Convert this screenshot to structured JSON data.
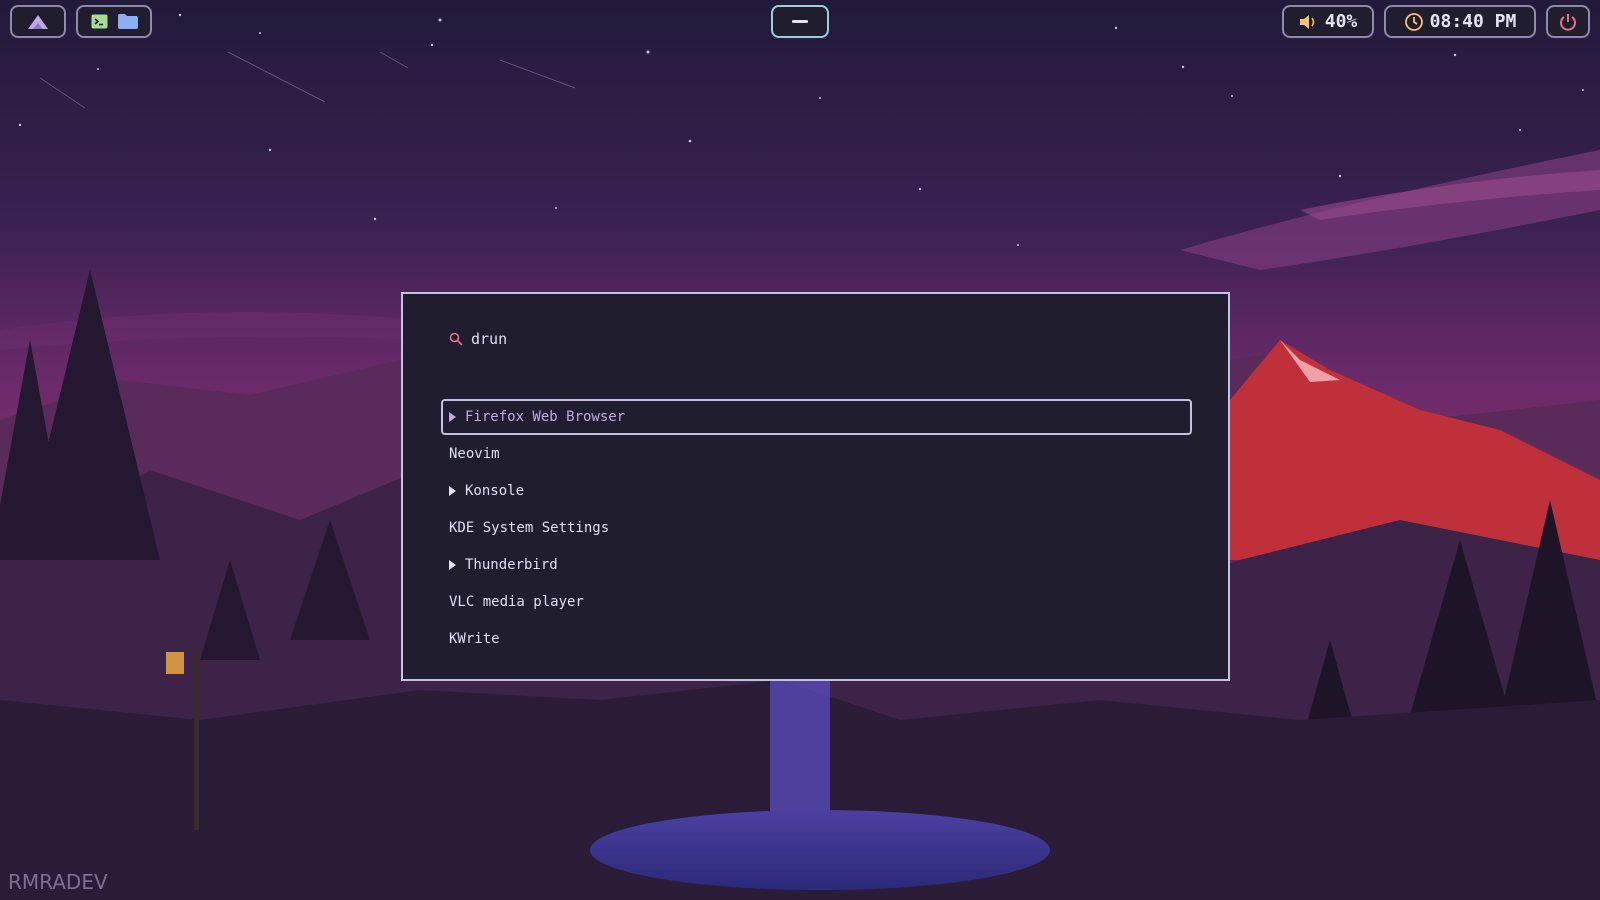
{
  "topbar": {
    "volume": "40%",
    "clock": "08:40 PM"
  },
  "launcher": {
    "mode": "drun",
    "items": [
      {
        "label": "Firefox Web Browser",
        "expandable": true,
        "selected": true
      },
      {
        "label": "Neovim",
        "expandable": false,
        "selected": false
      },
      {
        "label": "Konsole",
        "expandable": true,
        "selected": false
      },
      {
        "label": "KDE System Settings",
        "expandable": false,
        "selected": false
      },
      {
        "label": "Thunderbird",
        "expandable": true,
        "selected": false
      },
      {
        "label": "VLC media player",
        "expandable": false,
        "selected": false
      },
      {
        "label": "KWrite",
        "expandable": false,
        "selected": false
      }
    ]
  },
  "watermark": "RMRADEV",
  "colors": {
    "accent": "#c4a7e7",
    "border": "#c4c2e3",
    "panel": "#1f1d2e",
    "search_icon": "#eb6f92",
    "clock_icon": "#f6c177",
    "center_accent": "#9ccfd8"
  }
}
